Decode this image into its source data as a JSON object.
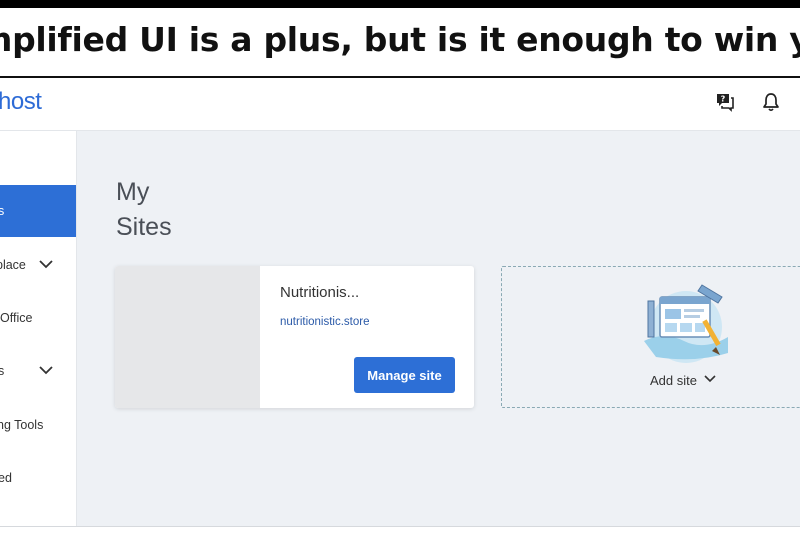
{
  "caption": {
    "text": "mplified UI is a plus, but is it enough to win you o"
  },
  "header": {
    "logo_text": "host",
    "icons": [
      "chat-icon",
      "bell-icon"
    ]
  },
  "sidebar": {
    "items": [
      {
        "label": "s",
        "active": true
      },
      {
        "label": "place",
        "has_chevron": true
      },
      {
        "label": "Office"
      },
      {
        "label": "s",
        "has_chevron": true
      },
      {
        "label": "ng Tools"
      },
      {
        "label": "ed"
      }
    ]
  },
  "main": {
    "title": "My Sites",
    "site": {
      "name": "Nutritionis...",
      "domain": "nutritionistic.store",
      "manage_label": "Manage site"
    },
    "add_site": {
      "label": "Add site"
    }
  },
  "colors": {
    "accent": "#2d6fd6",
    "background": "#eef1f5"
  }
}
